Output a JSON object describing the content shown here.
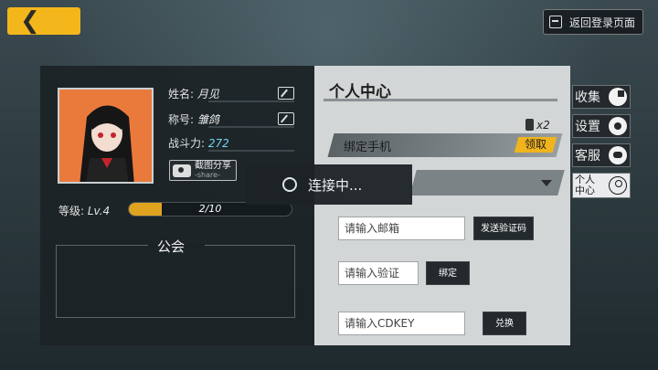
{
  "header": {
    "back_icon": "double-chevron-left-icon",
    "logout_label": "返回登录页面",
    "logout_icon": "exit-door-icon"
  },
  "profile": {
    "name_label": "姓名:",
    "name_value": "月见",
    "title_label": "称号:",
    "title_value": "雏鸽",
    "power_label": "战斗力:",
    "power_value": "272",
    "share_label": "截图分享",
    "share_sub": "-share-",
    "level_label": "等级:",
    "level_value": "Lv.4",
    "exp_text": "2/10",
    "exp_progress": 0.2
  },
  "guild": {
    "title": "公会"
  },
  "center": {
    "title": "个人中心",
    "reward_count": "x2",
    "bind_phone_label": "绑定手机",
    "claim_label": "领取",
    "email_placeholder": "请输入邮箱",
    "send_code_label": "发送验证码",
    "code_placeholder": "请输入验证",
    "bind_label": "绑定",
    "cdkey_placeholder": "请输入CDKEY",
    "redeem_label": "兑换"
  },
  "tabs": [
    {
      "label": "收集",
      "icon": "pie-chart-icon"
    },
    {
      "label": "设置",
      "icon": "gear-icon"
    },
    {
      "label": "客服",
      "icon": "chat-icon"
    },
    {
      "label": "个人中心",
      "icon": "user-icon"
    }
  ],
  "overlay": {
    "connecting_text": "连接中..."
  },
  "colors": {
    "accent": "#f3b71b",
    "power_value": "#6fd5ea"
  }
}
